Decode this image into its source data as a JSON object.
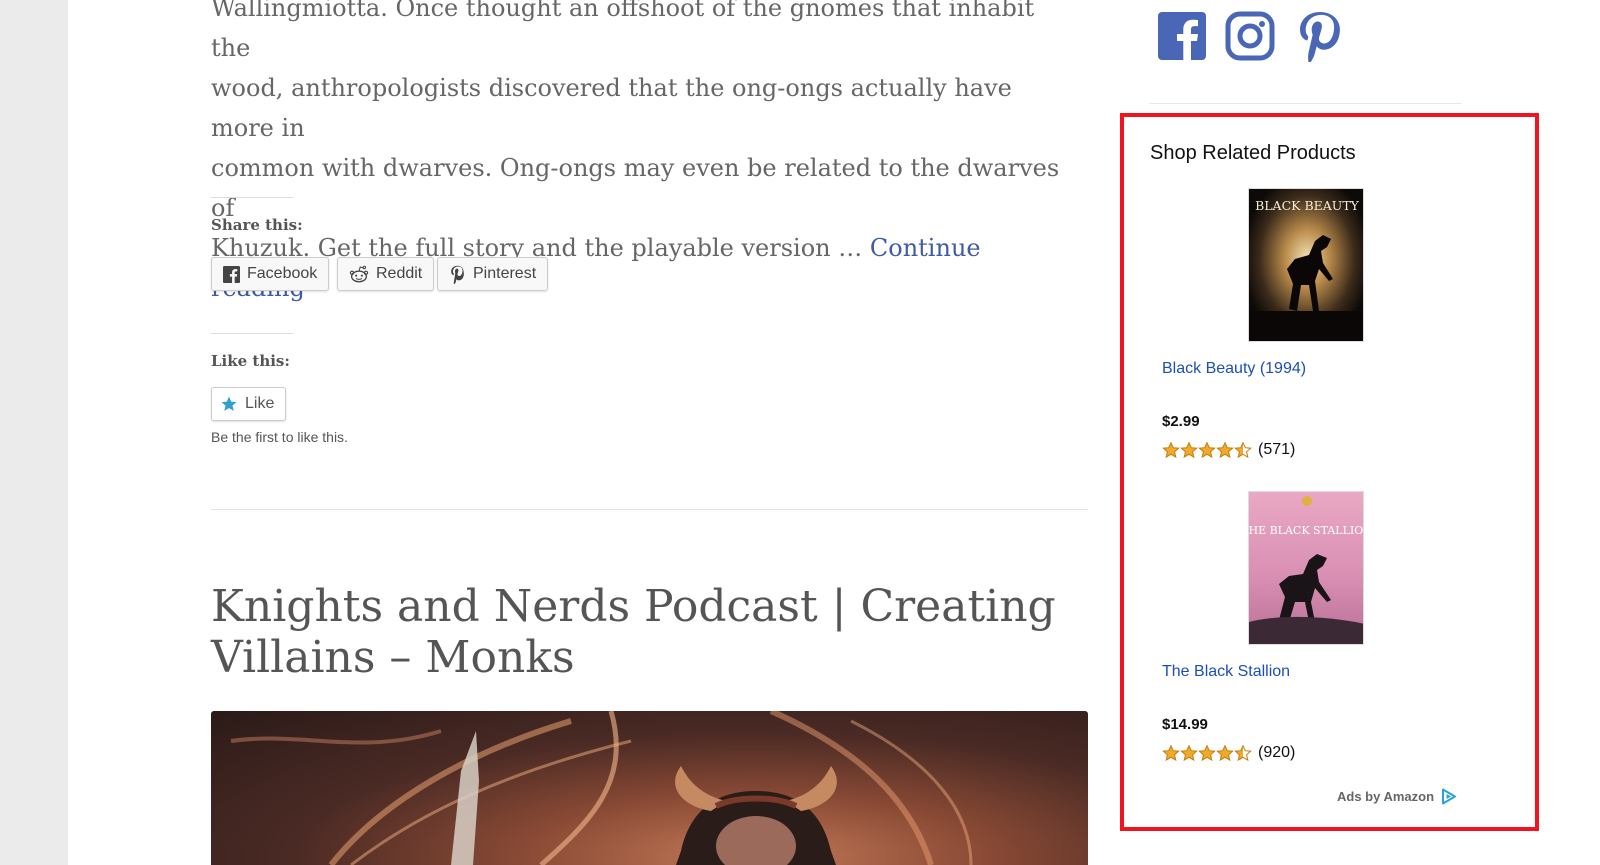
{
  "post_excerpt": {
    "line1": "Wallingmiotta. Once thought an offshoot of the gnomes that inhabit the",
    "line2": "wood, anthropologists discovered that the ong-ongs actually have more in",
    "line3": "common with dwarves. Ong-ongs may even be related to the dwarves of",
    "line4": "Khuzuk. Get the full story and the playable version … ",
    "continue_link": "Continue reading"
  },
  "share": {
    "title": "Share this:",
    "buttons": [
      {
        "label": "Facebook",
        "icon": "facebook-icon"
      },
      {
        "label": "Reddit",
        "icon": "reddit-icon"
      },
      {
        "label": "Pinterest",
        "icon": "pinterest-icon"
      }
    ]
  },
  "like": {
    "title": "Like this:",
    "button_label": "Like",
    "note": "Be the first to like this."
  },
  "next_post": {
    "title_line1": "Knights and Nerds Podcast | Creating",
    "title_line2": "Villains – Monks",
    "image": "monk-villain-illustration"
  },
  "sidebar": {
    "social_icons": [
      "facebook-icon",
      "instagram-icon",
      "pinterest-icon"
    ],
    "social_color": "#4a66b7"
  },
  "amazon_widget": {
    "title": "Shop Related Products",
    "highlight_color": "#f0141e",
    "link_color": "#1c4fb5",
    "products": [
      {
        "poster_text": "BLACK BEAUTY",
        "name": "Black Beauty (1994)",
        "price": "$2.99",
        "rating": 4.5,
        "reviews": "(571)"
      },
      {
        "poster_text": "THE BLACK STALLION",
        "name": "The Black Stallion",
        "price": "$14.99",
        "rating": 4.5,
        "reviews": "(920)"
      }
    ],
    "footer_label": "Ads by Amazon",
    "footer_icon": "adchoices-icon"
  }
}
